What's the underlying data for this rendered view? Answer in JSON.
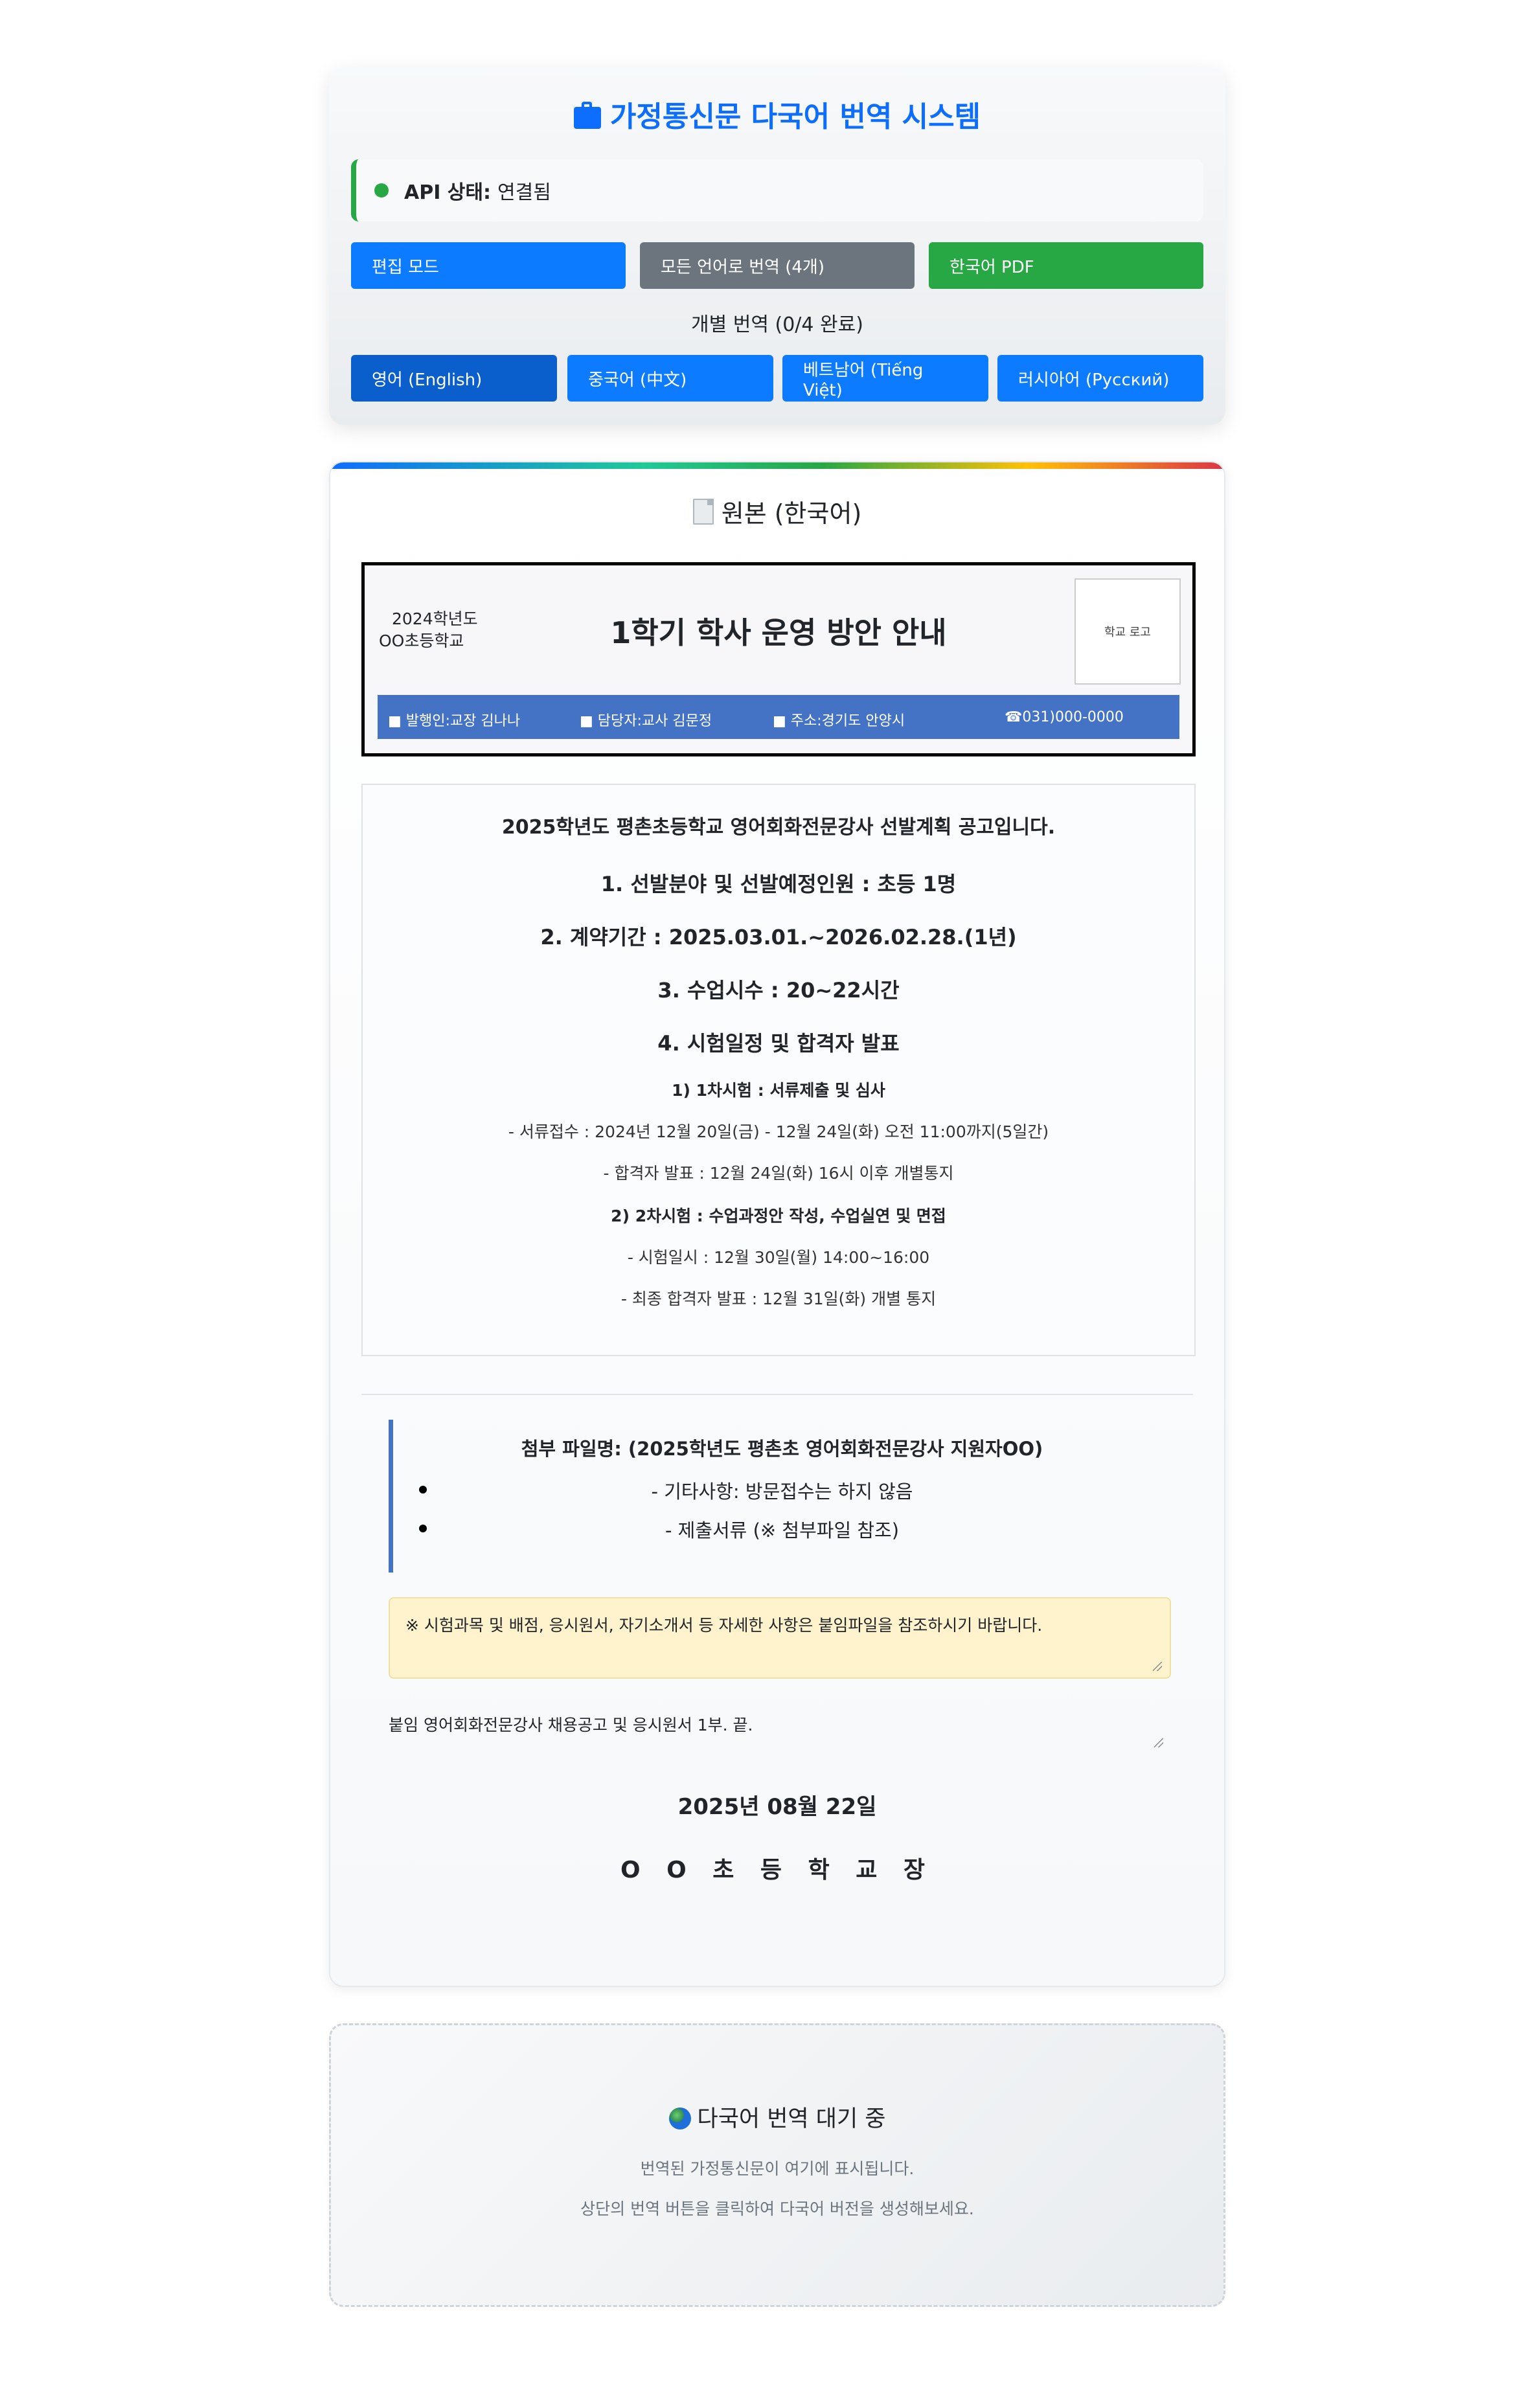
{
  "header": {
    "title": "가정통신문 다국어 번역 시스템",
    "api_label": "API 상태:",
    "api_value": "연결됨"
  },
  "toolbar": {
    "edit_mode": "편집 모드",
    "translate_all": "모든 언어로 번역 (4개)",
    "korean_pdf": "한국어 PDF"
  },
  "individual": {
    "label": "개별 번역 (0/4 완료)",
    "languages": [
      "영어 (English)",
      "중국어 (中文)",
      "베트남어 (Tiếng Việt)",
      "러시아어 (Русский)"
    ]
  },
  "original": {
    "title": "원본 (한국어)",
    "letterhead": {
      "year": "2024학년도",
      "school": "OO초등학교",
      "title": "1학기 학사 운영 방안 안내",
      "logo": "학교 로고",
      "publisher": "■ 발행인:교장 김나나",
      "manager": "■ 담당자:교사 김문정",
      "address": "■ 주소:경기도 안양시",
      "phone": "☎031)000-0000"
    },
    "content": {
      "headline": "2025학년도 평촌초등학교 영어회화전문강사 선발계획 공고입니다.",
      "item1": "1. 선발분야 및 선발예정인원 : 초등 1명",
      "item2": "2. 계약기간 : 2025.03.01.~2026.02.28.(1년)",
      "item3": "3. 수업시수 : 20~22시간",
      "item4": "4. 시험일정 및 합격자 발표",
      "round1": "1) 1차시험 : 서류제출 및 심사",
      "round1_a": "- 서류접수 : 2024년 12월 20일(금) - 12월 24일(화) 오전 11:00까지(5일간)",
      "round1_b": "- 합격자 발표 : 12월 24일(화) 16시 이후 개별통지",
      "round2": "2) 2차시험 : 수업과정안 작성, 수업실연 및 면접",
      "round2_a": "- 시험일시 : 12월 30일(월) 14:00~16:00",
      "round2_b": "- 최종 합격자 발표 : 12월 31일(화) 개별 통지"
    },
    "attachment": {
      "title": "첨부 파일명: (2025학년도 평촌초 영어회화전문강사 지원자OO)",
      "items": [
        "- 기타사항: 방문접수는 하지 않음",
        "- 제출서류 (※ 첨부파일 참조)"
      ]
    },
    "note": "※ 시험과목 및 배점, 응시원서, 자기소개서 등 자세한 사항은 붙임파일을 참조하시기 바랍니다.",
    "attach_note": "붙임 영어회화전문강사 채용공고 및 응시원서 1부. 끝.",
    "date": "2025년 08월 22일",
    "signature": "O O 초 등 학 교 장"
  },
  "waiting": {
    "title": "다국어 번역 대기 중",
    "line1": "번역된 가정통신문이 여기에 표시됩니다.",
    "line2": "상단의 번역 버튼을 클릭하여 다국어 버전을 생성해보세요."
  },
  "colors": {
    "accent": "#0d6efd",
    "success": "#28a745",
    "secondary": "#6c757d",
    "letterhead_bar": "#4472c4",
    "note_bg": "#fff3cd"
  },
  "icons": [
    "briefcase-icon",
    "status-dot-icon",
    "document-icon",
    "globe-icon"
  ]
}
